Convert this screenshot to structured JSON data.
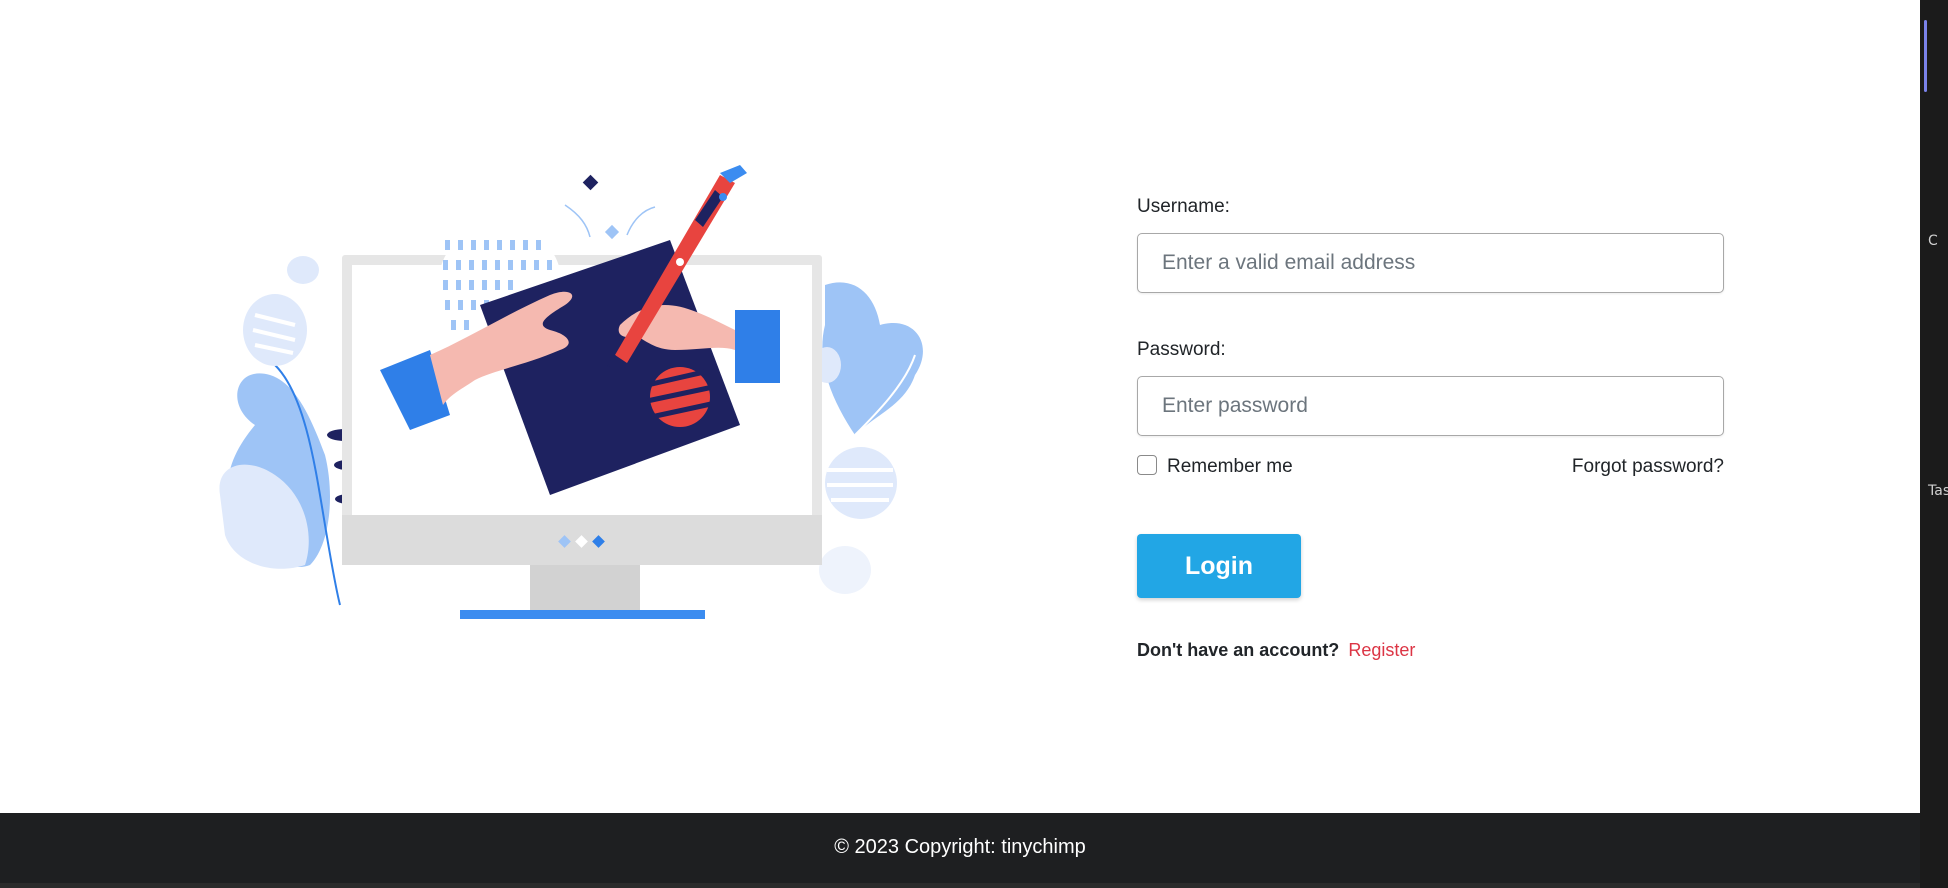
{
  "form": {
    "username_label": "Username:",
    "username_placeholder": "Enter a valid email address",
    "username_value": "",
    "password_label": "Password:",
    "password_placeholder": "Enter password",
    "password_value": "",
    "remember_label": "Remember me",
    "remember_checked": false,
    "forgot_label": "Forgot password?",
    "login_label": "Login",
    "register_prompt": "Don't have an account?",
    "register_label": "Register"
  },
  "footer": {
    "copyright": "© 2023 Copyright: tinychimp"
  },
  "side_panel": {
    "text_top": "C",
    "text_mid": "Tas"
  },
  "illustration": {
    "icon": "computer-drawing-illustration"
  },
  "colors": {
    "primary_button": "#22a6e5",
    "register_link": "#dc3545",
    "footer_bg": "#1e1f21",
    "illustration_navy": "#1e2260",
    "illustration_blue": "#2f7fe8",
    "illustration_red": "#e8443f"
  }
}
